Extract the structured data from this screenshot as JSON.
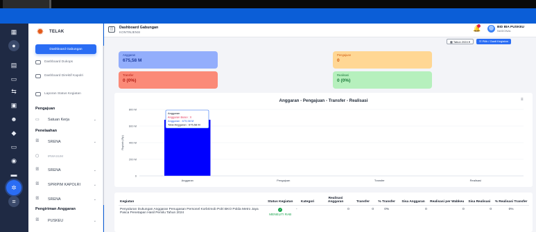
{
  "app": {
    "name": "TELAK"
  },
  "header": {
    "title": "Dashboard Gabungan",
    "subtitle": "KONTINJENSI",
    "user_name": "BID BIA PUSKEU",
    "user_role": "NASIONAL",
    "collapse_glyph": "◫",
    "bell_glyph": "🔔"
  },
  "sidebar": {
    "active_item": "Dashboard Gabungan",
    "items": [
      {
        "label": "Dashboard Dukops"
      },
      {
        "label": "Dashboard Direktif Kapolri"
      },
      {
        "label": "Laporan Status Kegiatan"
      }
    ],
    "pengajuan": {
      "heading": "Pengajuan",
      "items": [
        {
          "label": "Satuan Kerja",
          "icon": "▭"
        }
      ]
    },
    "penelaahan": {
      "heading": "Penelaahan",
      "items": [
        {
          "label": "SRENA",
          "icon": "ꕥ",
          "muted": false
        },
        {
          "label": "IRWASUM",
          "icon": "⬡",
          "muted": true
        },
        {
          "label": "SRENA",
          "icon": "ꕥ",
          "muted": false
        },
        {
          "label": "SPRIPIM KAPOLRI",
          "icon": "ꕥ",
          "muted": false
        },
        {
          "label": "SRENA",
          "icon": "ꕥ",
          "muted": false
        }
      ]
    },
    "pengiriman": {
      "heading": "Pengiriman Anggaran",
      "items": [
        {
          "label": "PUSKEU",
          "icon": "ꕥ"
        }
      ]
    },
    "chevron": "⌄"
  },
  "rail": {
    "icons": [
      "grid-icon",
      "avatar-icon",
      "wallet-icon",
      "car-icon",
      "exchange-icon",
      "money-icon",
      "people-icon",
      "tag-icon",
      "card-icon",
      "wifi-icon",
      "car2-icon",
      "settings-icon",
      "menu-icon"
    ]
  },
  "filters": {
    "year": "Tahun 2024",
    "button": "Pilih / Ganti Kegiatan"
  },
  "cards": [
    {
      "label": "Anggaran",
      "value": "675,58 M"
    },
    {
      "label": "Pengajuan",
      "value": "0"
    },
    {
      "label": "Transfer",
      "value": "0 (0%)"
    },
    {
      "label": "Realisasi",
      "value": "0 (0%)"
    }
  ],
  "chart_menu": "≡",
  "chart_data": {
    "type": "bar",
    "title": "Anggaran - Pengajuan - Transfer - Realisasi",
    "categories": [
      "Anggaran",
      "Pengajuan",
      "Transfer",
      "Realisasi"
    ],
    "values": [
      675.58,
      0,
      0,
      0
    ],
    "ylabel": "Rupiah (Rp)",
    "yticks": [
      "0",
      "200 M",
      "400 M",
      "600 M",
      "800 M"
    ],
    "ylim": [
      0,
      800
    ],
    "bar_color": "#0000ff",
    "tooltip": {
      "title": "Anggaran",
      "line1": "Anggaran Bulan : 0",
      "line2": "Anggaran : 675,58 M",
      "line3": "Total Anggaran : 675,58 M"
    }
  },
  "table": {
    "headers": [
      "Kegiatan",
      "Status Kegiatan",
      "Kategori",
      "Realisasi Anggaran",
      "Transfer",
      "% Transfer",
      "Sisa Anggaran",
      "Realisasi per Wabkeu",
      "Sisa Realisasi",
      "% Realisasi Transfer"
    ],
    "rows": [
      {
        "kegiatan": "Penyaluran Dukungan Anggaran Penugasan Personel Korbrimob Polri BKO Polda Metro Jaya Pasca Penetapan Hasil Pemilu Tahun 2024",
        "status": "MENELITI RAB",
        "kategori": "-",
        "realisasi_anggaran": "0",
        "transfer": "0",
        "pct_transfer": "0%",
        "sisa_anggaran": "0",
        "realisasi_wabkeu": "0",
        "sisa_realisasi": "0",
        "pct_realisasi_transfer": "0%"
      }
    ]
  }
}
